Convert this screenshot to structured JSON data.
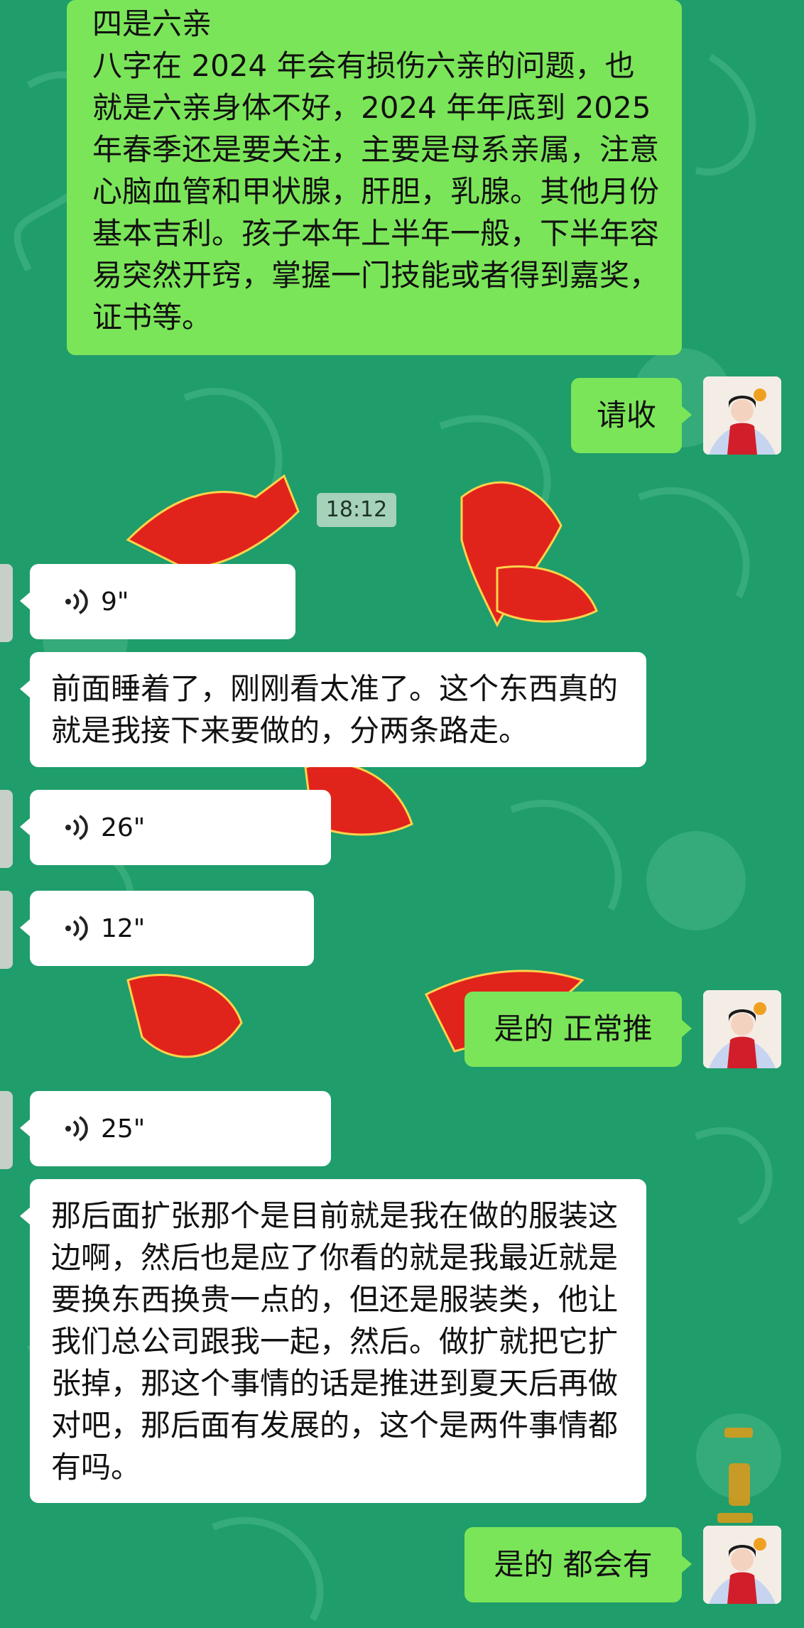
{
  "messages": {
    "m1": {
      "title": "四是六亲",
      "body": "八字在 2024 年会有损伤六亲的问题，也就是六亲身体不好，2024 年年底到 2025 年春季还是要关注，主要是母系亲属，注意心脑血管和甲状腺，肝胆，乳腺。其他月份基本吉利。孩子本年上半年一般，下半年容易突然开窍，掌握一门技能或者得到嘉奖，证书等。"
    },
    "m2": "请收",
    "timestamp": "18:12",
    "v1": "9\"",
    "m3": "前面睡着了，刚刚看太准了。这个东西真的就是我接下来要做的，分两条路走。",
    "v2": "26\"",
    "v3": "12\"",
    "m4": "是的 正常推",
    "v4": "25\"",
    "m5": "那后面扩张那个是目前就是我在做的服装这边啊，然后也是应了你看的就是我最近就是要换东西换贵一点的，但还是服装类，他让我们总公司跟我一起，然后。做扩就把它扩张掉，那这个事情的话是推进到夏天后再做对吧，那后面有发展的，这个是两件事情都有吗。",
    "m6": "是的 都会有"
  },
  "icons": {
    "voice": "voice-wave-icon",
    "avatar": "avatar-icon"
  },
  "colors": {
    "background": "#1f9d6b",
    "outgoing_bubble": "#7be559",
    "incoming_bubble": "#ffffff",
    "background_art": "#e0241c"
  }
}
